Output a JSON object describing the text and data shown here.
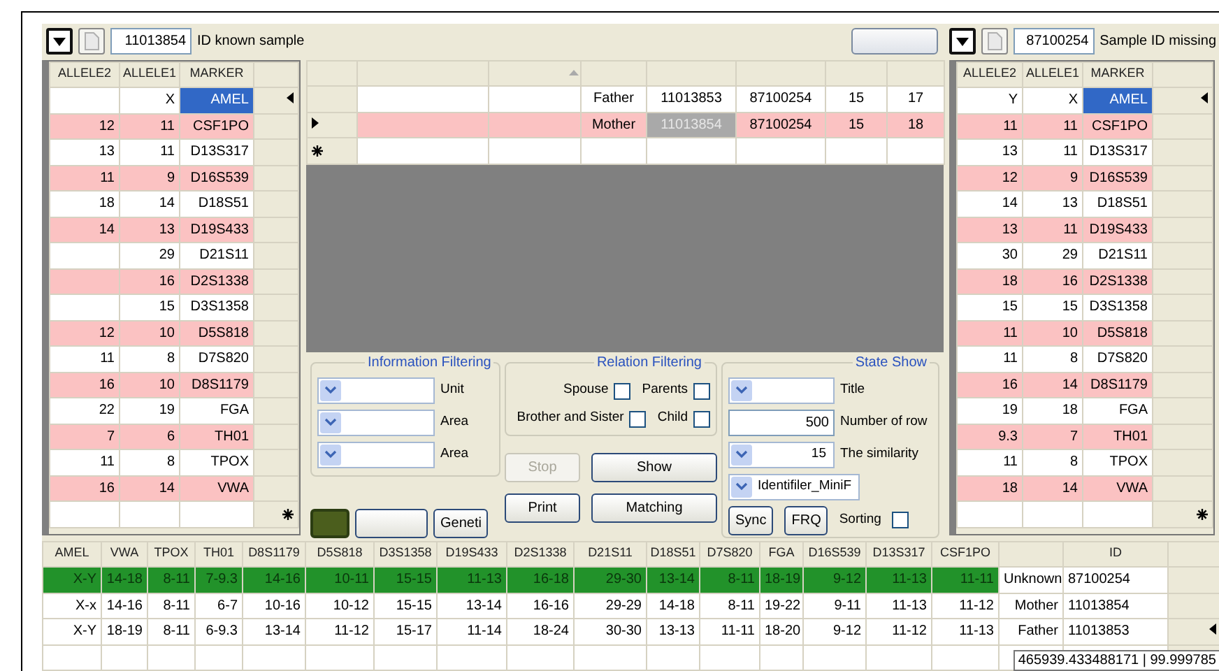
{
  "toolbar_left": {
    "sample_id": "11013854",
    "label": "ID known sample"
  },
  "toolbar_right": {
    "sample_id": "87100254",
    "label": "Sample ID missing"
  },
  "known_sample_grid": {
    "columns": [
      "ALLELE2",
      "ALLELE1",
      "MARKER"
    ],
    "rows": [
      {
        "allele1": "X",
        "marker": "AMEL",
        "highlighted": false,
        "marker_selected": true,
        "current": true
      },
      {
        "allele2": "12",
        "allele1": "11",
        "marker": "CSF1PO",
        "highlighted": true,
        "marker_selected": false,
        "current": false
      },
      {
        "allele2": "13",
        "allele1": "11",
        "marker": "D13S317",
        "highlighted": false,
        "marker_selected": false,
        "current": false
      },
      {
        "allele2": "11",
        "allele1": "9",
        "marker": "D16S539",
        "highlighted": true,
        "marker_selected": false,
        "current": false
      },
      {
        "allele2": "18",
        "allele1": "14",
        "marker": "D18S51",
        "highlighted": false,
        "marker_selected": false,
        "current": false
      },
      {
        "allele2": "14",
        "allele1": "13",
        "marker": "D19S433",
        "highlighted": true,
        "marker_selected": false,
        "current": false
      },
      {
        "allele1": "29",
        "marker": "D21S11",
        "highlighted": false,
        "marker_selected": false,
        "current": false
      },
      {
        "allele1": "16",
        "marker": "D2S1338",
        "highlighted": true,
        "marker_selected": false,
        "current": false
      },
      {
        "allele1": "15",
        "marker": "D3S1358",
        "highlighted": false,
        "marker_selected": false,
        "current": false
      },
      {
        "allele2": "12",
        "allele1": "10",
        "marker": "D5S818",
        "highlighted": true,
        "marker_selected": false,
        "current": false
      },
      {
        "allele2": "11",
        "allele1": "8",
        "marker": "D7S820",
        "highlighted": false,
        "marker_selected": false,
        "current": false
      },
      {
        "allele2": "16",
        "allele1": "10",
        "marker": "D8S1179",
        "highlighted": true,
        "marker_selected": false,
        "current": false
      },
      {
        "allele2": "22",
        "allele1": "19",
        "marker": "FGA",
        "highlighted": false,
        "marker_selected": false,
        "current": false
      },
      {
        "allele2": "7",
        "allele1": "6",
        "marker": "TH01",
        "highlighted": true,
        "marker_selected": false,
        "current": false
      },
      {
        "allele2": "11",
        "allele1": "8",
        "marker": "TPOX",
        "highlighted": false,
        "marker_selected": false,
        "current": false
      },
      {
        "allele2": "16",
        "allele1": "14",
        "marker": "VWA",
        "highlighted": true,
        "marker_selected": false,
        "current": false
      }
    ]
  },
  "relatives_table": {
    "columns": [
      {
        "sorted": false
      },
      {
        "sorted": true
      },
      {
        "sorted": false
      },
      {
        "sorted": false
      },
      {
        "sorted": false
      },
      {
        "sorted": false
      },
      {
        "sorted": false
      }
    ],
    "rows": [
      {
        "relation": "Father",
        "sample_id": "11013853",
        "reference_id": "87100254",
        "column_6": "15",
        "column_7": "17",
        "highlighted": false,
        "current": false,
        "sample_id_selected": false
      },
      {
        "relation": "Mother",
        "sample_id": "11013854",
        "reference_id": "87100254",
        "column_6": "15",
        "column_7": "18",
        "highlighted": true,
        "current": true,
        "sample_id_selected": true
      }
    ]
  },
  "information_filtering": {
    "title": "Information Filtering",
    "fields": [
      {
        "label": "Unit"
      },
      {
        "label": "Area"
      },
      {
        "label": "Area"
      }
    ]
  },
  "relation_filtering": {
    "title": "Relation Filtering",
    "options": [
      {
        "label": "Spouse",
        "checked": false
      },
      {
        "label": "Parents",
        "checked": false
      },
      {
        "label": "Brother and Sister",
        "checked": false
      },
      {
        "label": "Child",
        "checked": false
      }
    ]
  },
  "state_show": {
    "title": "State Show",
    "fields": [
      {
        "kind": "combo",
        "label": "Title"
      },
      {
        "kind": "input",
        "value": "500",
        "label": "Number of row"
      },
      {
        "kind": "combo",
        "value": "15",
        "label": "The similarity"
      },
      {
        "kind": "combo",
        "value": "Identifiler_MiniF"
      }
    ]
  },
  "tool_buttons": [
    {
      "kind": "swatch"
    },
    {
      "kind": "blank"
    },
    {
      "kind": "text",
      "label": "Geneti"
    }
  ],
  "action_buttons": [
    {
      "label": "Stop",
      "disabled": true
    },
    {
      "label": "Show",
      "disabled": false
    },
    {
      "label": "Print",
      "disabled": false
    },
    {
      "label": "Matching",
      "disabled": false
    }
  ],
  "state_buttons": [
    {
      "label": "Sync"
    },
    {
      "label": "FRQ"
    }
  ],
  "sorting": {
    "label": "Sorting",
    "checked": false
  },
  "missing_sample_grid": {
    "columns": [
      "ALLELE2",
      "ALLELE1",
      "MARKER"
    ],
    "rows": [
      {
        "allele2": "Y",
        "allele1": "X",
        "marker": "AMEL",
        "highlighted": false,
        "marker_selected": true,
        "current": true
      },
      {
        "allele2": "11",
        "allele1": "11",
        "marker": "CSF1PO",
        "highlighted": true,
        "marker_selected": false,
        "current": false
      },
      {
        "allele2": "13",
        "allele1": "11",
        "marker": "D13S317",
        "highlighted": false,
        "marker_selected": false,
        "current": false
      },
      {
        "allele2": "12",
        "allele1": "9",
        "marker": "D16S539",
        "highlighted": true,
        "marker_selected": false,
        "current": false
      },
      {
        "allele2": "14",
        "allele1": "13",
        "marker": "D18S51",
        "highlighted": false,
        "marker_selected": false,
        "current": false
      },
      {
        "allele2": "13",
        "allele1": "11",
        "marker": "D19S433",
        "highlighted": true,
        "marker_selected": false,
        "current": false
      },
      {
        "allele2": "30",
        "allele1": "29",
        "marker": "D21S11",
        "highlighted": false,
        "marker_selected": false,
        "current": false
      },
      {
        "allele2": "18",
        "allele1": "16",
        "marker": "D2S1338",
        "highlighted": true,
        "marker_selected": false,
        "current": false
      },
      {
        "allele2": "15",
        "allele1": "15",
        "marker": "D3S1358",
        "highlighted": false,
        "marker_selected": false,
        "current": false
      },
      {
        "allele2": "11",
        "allele1": "10",
        "marker": "D5S818",
        "highlighted": true,
        "marker_selected": false,
        "current": false
      },
      {
        "allele2": "11",
        "allele1": "8",
        "marker": "D7S820",
        "highlighted": false,
        "marker_selected": false,
        "current": false
      },
      {
        "allele2": "16",
        "allele1": "14",
        "marker": "D8S1179",
        "highlighted": true,
        "marker_selected": false,
        "current": false
      },
      {
        "allele2": "19",
        "allele1": "18",
        "marker": "FGA",
        "highlighted": false,
        "marker_selected": false,
        "current": false
      },
      {
        "allele2": "9.3",
        "allele1": "7",
        "marker": "TH01",
        "highlighted": true,
        "marker_selected": false,
        "current": false
      },
      {
        "allele2": "11",
        "allele1": "8",
        "marker": "TPOX",
        "highlighted": false,
        "marker_selected": false,
        "current": false
      },
      {
        "allele2": "18",
        "allele1": "14",
        "marker": "VWA",
        "highlighted": true,
        "marker_selected": false,
        "current": false
      }
    ]
  },
  "profile_table": {
    "locus_columns": [
      "AMEL",
      "VWA",
      "TPOX",
      "TH01",
      "D8S1179",
      "D5S818",
      "D3S1358",
      "D19S433",
      "D2S1338",
      "D21S11",
      "D18S51",
      "D7S820",
      "FGA",
      "D16S539",
      "D13S317",
      "CSF1PO"
    ],
    "id_column": "ID",
    "rows": [
      {
        "alleles": [
          "X-Y",
          "14-18",
          "8-11",
          "7-9.3",
          "14-16",
          "10-11",
          "15-15",
          "11-13",
          "16-18",
          "29-30",
          "13-14",
          "8-11",
          "18-19",
          "9-12",
          "11-13",
          "11-11"
        ],
        "relation": "Unknown",
        "id": "87100254",
        "matched": true,
        "current": false
      },
      {
        "alleles": [
          "X-x",
          "14-16",
          "8-11",
          "6-7",
          "10-16",
          "10-12",
          "15-15",
          "13-14",
          "16-16",
          "29-29",
          "14-18",
          "8-11",
          "19-22",
          "9-11",
          "11-13",
          "11-12"
        ],
        "relation": "Mother",
        "id": "11013854",
        "matched": false,
        "current": false
      },
      {
        "alleles": [
          "X-Y",
          "18-19",
          "8-11",
          "6-9.3",
          "13-14",
          "11-12",
          "15-17",
          "11-14",
          "18-24",
          "30-30",
          "13-13",
          "11-11",
          "18-20",
          "9-12",
          "11-12",
          "11-13"
        ],
        "relation": "Father",
        "id": "11013853",
        "matched": false,
        "current": true
      }
    ]
  },
  "status": "465939.433488171 | 99.999785"
}
